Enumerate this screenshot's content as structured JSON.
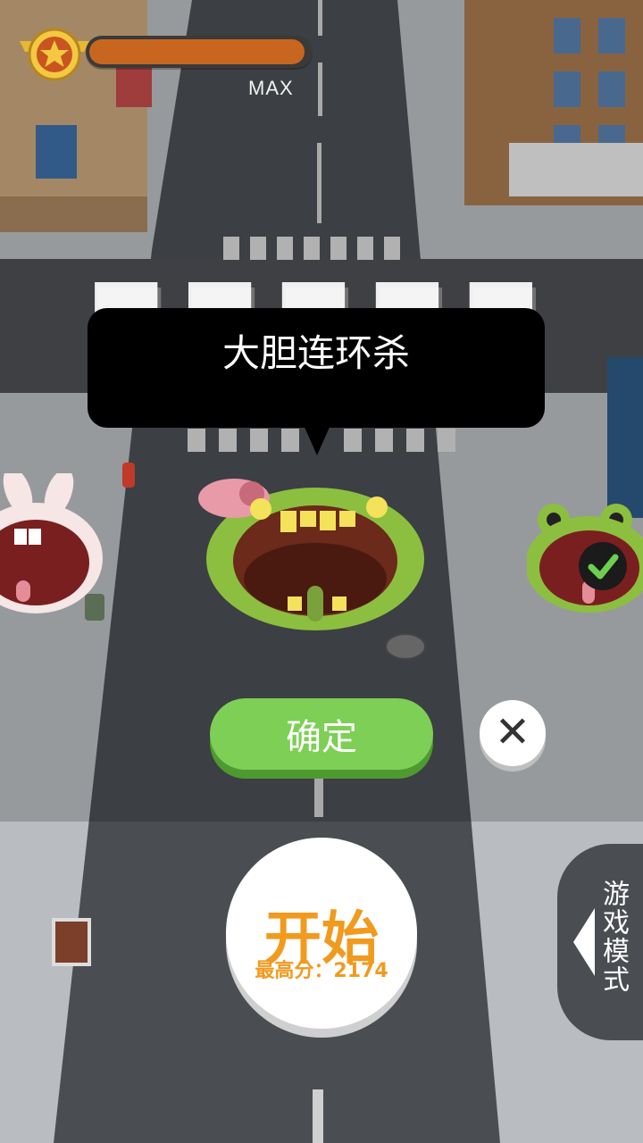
{
  "hud": {
    "level_max_label": "MAX",
    "xp_progress": 0.98
  },
  "speech_bubble": {
    "text": "大胆连环杀"
  },
  "buttons": {
    "confirm_label": "确定",
    "close_glyph": "✕"
  },
  "start": {
    "label": "开始",
    "best_score_label": "最高分：",
    "best_score_value": "2174"
  },
  "mode_tab": {
    "label": "游戏模式"
  },
  "icons": [
    "star-rank-badge-icon",
    "checkmark-icon",
    "close-icon",
    "arrow-left-icon"
  ],
  "colors": {
    "confirm": "#7dcf55",
    "start_text": "#f19a1e",
    "xp_fill": "#c8661f"
  }
}
